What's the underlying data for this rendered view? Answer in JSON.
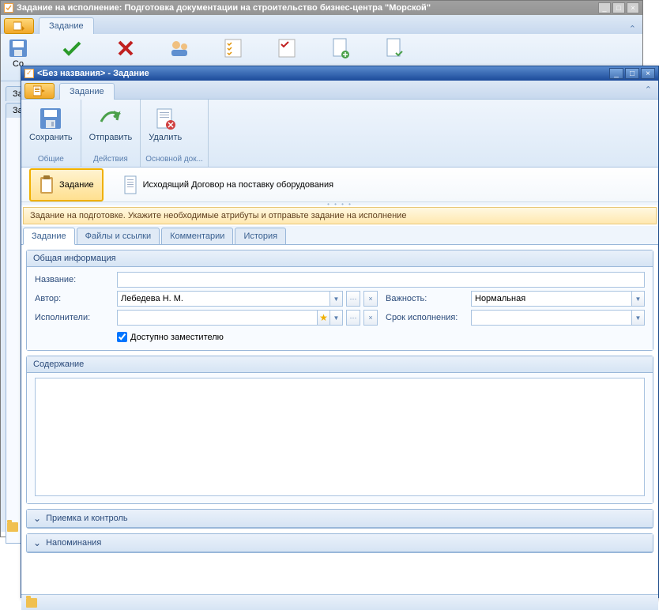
{
  "bg": {
    "title": "Задание на исполнение: Подготовка документации на строительство бизнес-центра \"Морской\"",
    "tab": "Задание",
    "save_label_short": "Со",
    "inner_tabs": [
      "За",
      "За"
    ]
  },
  "fg": {
    "title": "<Без названия> - Задание",
    "ribbon_tab": "Задание",
    "ribbon": {
      "save": "Сохранить",
      "send": "Отправить",
      "delete": "Удалить",
      "group_general": "Общие",
      "group_actions": "Действия",
      "group_doc": "Основной док..."
    },
    "context": {
      "task": "Задание",
      "doc": "Исходящий Договор на поставку оборудования"
    },
    "status": "Задание на подготовке. Укажите необходимые атрибуты и отправьте задание на исполнение",
    "tabs": [
      "Задание",
      "Файлы и ссылки",
      "Комментарии",
      "История"
    ],
    "groups": {
      "general": "Общая информация",
      "content": "Содержание",
      "acceptance": "Приемка и контроль",
      "reminders": "Напоминания"
    },
    "fields": {
      "name_label": "Название:",
      "name_value": "",
      "author_label": "Автор:",
      "author_value": "Лебедева Н. М.",
      "executors_label": "Исполнители:",
      "executors_value": "",
      "substitute_label": "Доступно заместителю",
      "importance_label": "Важность:",
      "importance_value": "Нормальная",
      "deadline_label": "Срок исполнения:",
      "deadline_value": "",
      "content_value": ""
    }
  }
}
